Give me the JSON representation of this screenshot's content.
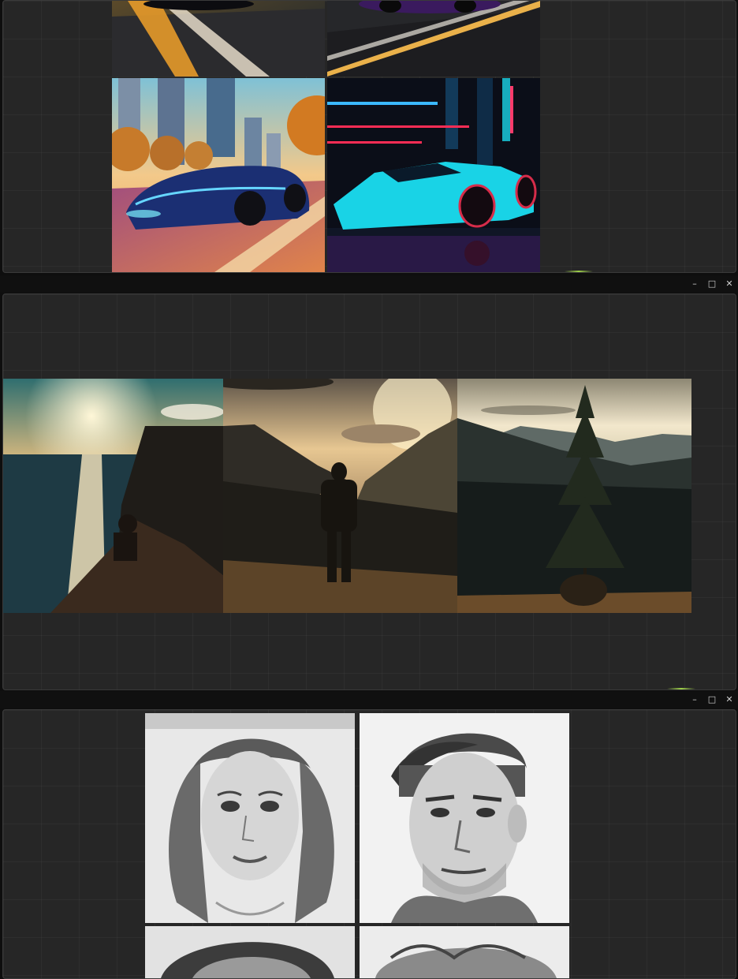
{
  "window_controls": {
    "minimize": "–",
    "maximize": "□",
    "close": "✕"
  },
  "panels": [
    {
      "id": "cars",
      "images": [
        "car-road-orange",
        "car-road-purple",
        "car-city-blue",
        "car-neon-cyan"
      ]
    },
    {
      "id": "landscape",
      "images": [
        "sunset-sea-cliff",
        "person-on-hill",
        "pine-tree-forest"
      ]
    },
    {
      "id": "portraits",
      "images": [
        "sketch-woman",
        "sketch-man",
        "sketch-child-1",
        "sketch-child-2"
      ]
    }
  ],
  "colors": {
    "panel_bg": "#262626",
    "titlebar_bg": "#101010",
    "accent": "#9fd14a"
  }
}
